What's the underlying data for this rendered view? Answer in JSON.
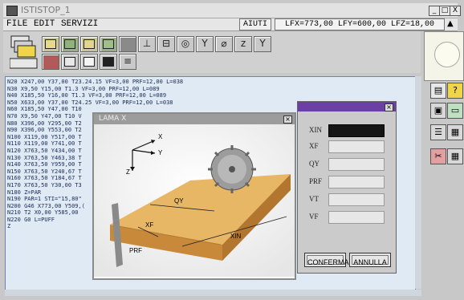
{
  "window": {
    "title": "ISTISTOP_1",
    "controls": [
      "_",
      "□",
      "X"
    ]
  },
  "menu": {
    "items": [
      "FILE",
      "EDIT",
      "SERVIZI"
    ],
    "help": "AIUTI",
    "status": "LFX=773,00 LFY=600,00 LFZ=18,00",
    "scroll_up_icon": "▲"
  },
  "toolbar": {
    "icons": [
      "stack-icon",
      "layers-icon",
      "tool-icon",
      "tool-icon",
      "tool-icon",
      "tool-icon",
      "clamp-icon",
      "fixture-icon",
      "drill-icon",
      "funnel-icon",
      "sensor-icon",
      "z-axis-icon",
      "funnel-icon",
      "panel-icon",
      "grid-icon",
      "frame-icon",
      "board-icon",
      "lines-icon"
    ]
  },
  "editor": {
    "lines": [
      "N20 X247,00 Y37,00 T23.24.15 VF=3,00 PRF=12,00 L=038",
      "N30 X9,50 Y15,00 T1.3 VF=3,00 PRF=12,00 L=089",
      "N40 X185,50 Y16,00 T1.3 VF=3,00 PRF=12,00 L=089",
      "N50 X633,00 Y37,00 T24.25 VF=3,00 PRF=12,00 L=038",
      "N60 X185,50 Y47,00 T10",
      "N70 X9,50 Y47,00 T10 V",
      "N80 X396,00 Y295,00 T2",
      "N90 X396,00 Y553,00 T2",
      "N100 X119,00 Y517,00 T",
      "N110 X119,00 Y741,00 T",
      "N120 X763,50 Y434,00 T",
      "N130 X763,50 Y463,38 T",
      "N140 X763,50 Y959,00 T",
      "N150 X763,50 Y240,67 T",
      "N160 X763,50 Y184,67 T",
      "N170 X763,50 Y30,00 T3",
      "N180 Z=PAR",
      "N190 PAR=1 STI=\"15,80\"",
      "N200 G46 X773,00 Y509,(",
      "N210 T2 X0,00 Y585,00",
      "N220 G0 L=PUFF",
      "Z"
    ]
  },
  "image_window": {
    "title": "LAMA X",
    "labels": {
      "axis_x": "X",
      "axis_y": "Y",
      "axis_z": "Z",
      "qy": "QY",
      "xf": "XF",
      "prf": "PRF",
      "xin": "XIN"
    }
  },
  "dialog": {
    "fields": [
      {
        "label": "XIN",
        "value": ""
      },
      {
        "label": "XF",
        "value": ""
      },
      {
        "label": "QY",
        "value": ""
      },
      {
        "label": "PRF",
        "value": ""
      },
      {
        "label": "VT",
        "value": ""
      },
      {
        "label": "VF",
        "value": ""
      }
    ],
    "confirm_label": "CONFERMA",
    "cancel_label": "ANNULLA"
  },
  "colors": {
    "dialog_title": "#6b3fa3",
    "editor_bg": "#dfeaf5",
    "board": "#d9a24b"
  }
}
